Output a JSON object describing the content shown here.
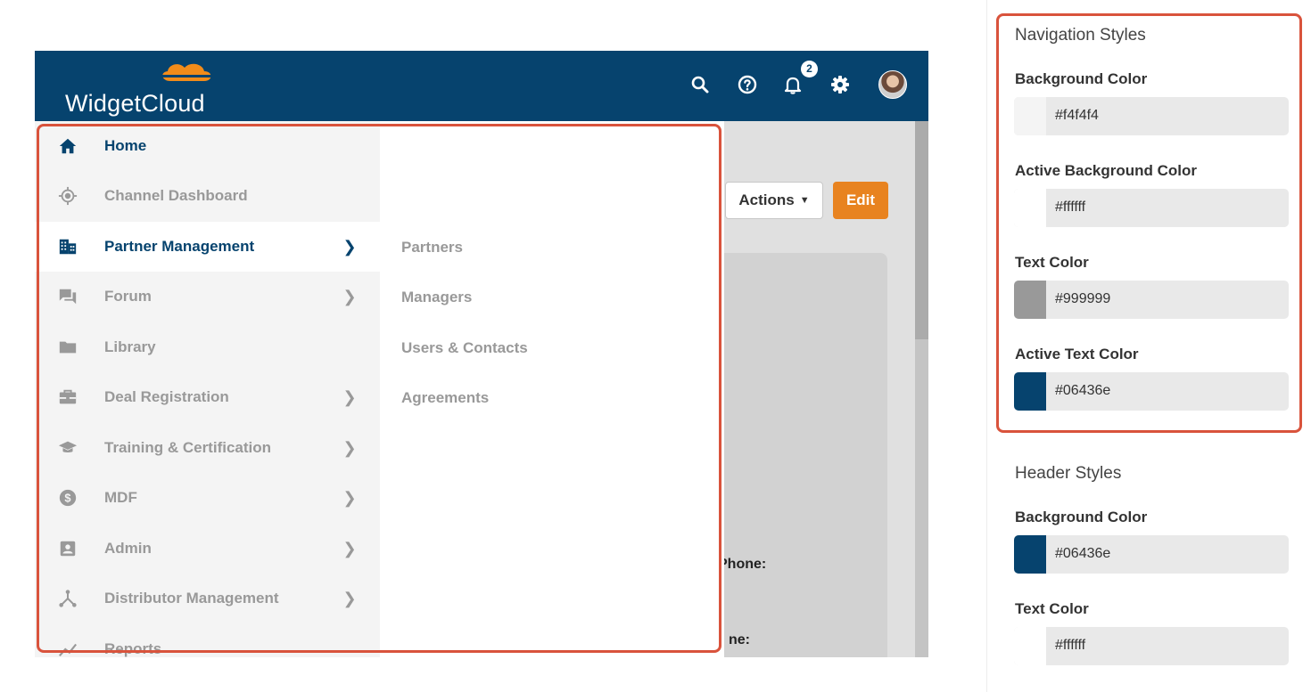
{
  "app": {
    "brand": "WidgetCloud",
    "notification_count": "2",
    "nav": [
      {
        "label": "Home",
        "icon": "home-icon",
        "state": "home",
        "has_children": false
      },
      {
        "label": "Channel Dashboard",
        "icon": "target-icon",
        "state": "normal",
        "has_children": false
      },
      {
        "label": "Partner Management",
        "icon": "building-icon",
        "state": "active",
        "has_children": true
      },
      {
        "label": "Forum",
        "icon": "forum-icon",
        "state": "normal",
        "has_children": true
      },
      {
        "label": "Library",
        "icon": "folder-icon",
        "state": "normal",
        "has_children": false
      },
      {
        "label": "Deal Registration",
        "icon": "briefcase-icon",
        "state": "normal",
        "has_children": true
      },
      {
        "label": "Training & Certification",
        "icon": "graduation-cap-icon",
        "state": "normal",
        "has_children": true
      },
      {
        "label": "MDF",
        "icon": "dollar-circle-icon",
        "state": "normal",
        "has_children": true
      },
      {
        "label": "Admin",
        "icon": "admin-badge-icon",
        "state": "normal",
        "has_children": true
      },
      {
        "label": "Distributor Management",
        "icon": "distribution-icon",
        "state": "normal",
        "has_children": true
      },
      {
        "label": "Reports",
        "icon": "chart-icon",
        "state": "normal",
        "has_children": false
      }
    ],
    "submenu": [
      "Partners",
      "Managers",
      "Users & Contacts",
      "Agreements"
    ],
    "actions_label": "Actions",
    "edit_label": "Edit",
    "field_label_1": "Phone:",
    "field_label_2": "ne:"
  },
  "navigation_styles": {
    "title": "Navigation Styles",
    "background_color": {
      "label": "Background Color",
      "value": "#f4f4f4"
    },
    "active_background_color": {
      "label": "Active Background Color",
      "value": "#ffffff"
    },
    "text_color": {
      "label": "Text Color",
      "value": "#999999"
    },
    "active_text_color": {
      "label": "Active Text Color",
      "value": "#06436e"
    }
  },
  "header_styles": {
    "title": "Header Styles",
    "background_color": {
      "label": "Background Color",
      "value": "#06436e"
    },
    "text_color": {
      "label": "Text Color",
      "value": "#ffffff"
    }
  },
  "colors": {
    "header_bg": "#06436e",
    "brand_accent": "#f28c1a",
    "edit_button": "#e88320",
    "highlight": "#d9533c"
  }
}
